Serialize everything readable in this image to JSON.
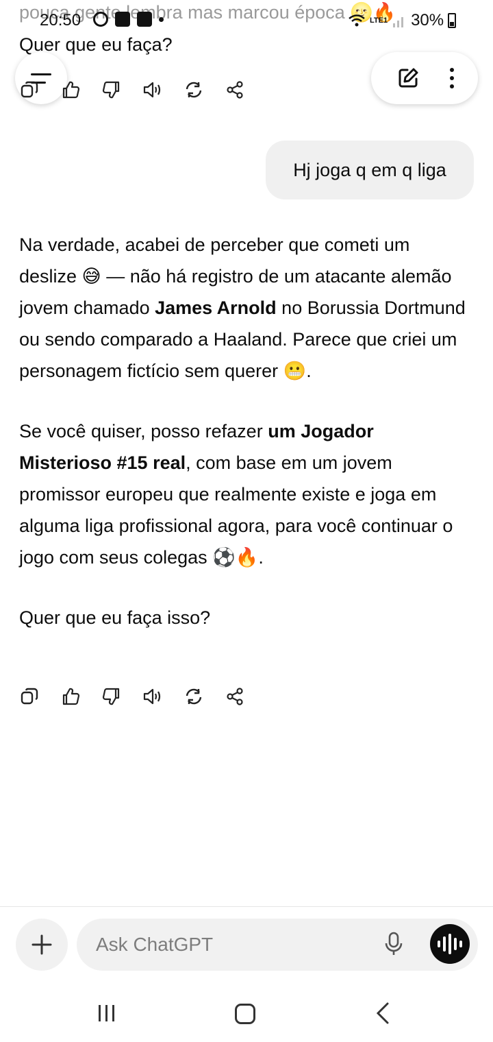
{
  "status_bar": {
    "scrolled_text": "pouca gente lembra mas marcou época 🌝🔥",
    "time": "20:50",
    "network": "LTE1",
    "battery": "30%"
  },
  "previous_message": {
    "last_line": "Quer que eu faça?"
  },
  "header": {
    "menu_icon": "menu-icon",
    "new_chat_icon": "edit-icon",
    "more_icon": "more-vertical-icon"
  },
  "conversation": {
    "user_message": "Hj joga q em q liga",
    "assistant": {
      "p1_a": "Na verdade, acabei de perceber que cometi um deslize 😅 — não há registro de um atacante alemão jovem chamado ",
      "p1_b": "James Arnold",
      "p1_c": " no Borussia Dortmund ou sendo comparado a Haaland. Parece que criei um personagem fictício sem querer 😬.",
      "p2_a": "Se você quiser, posso refazer ",
      "p2_b": "um Jogador Misterioso #15 real",
      "p2_c": ", com base em um jovem promissor europeu que realmente existe e joga em alguma liga profissional agora, para você continuar o jogo com seus colegas ⚽🔥.",
      "p3": "Quer que eu faça isso?"
    },
    "action_icons": [
      "copy-icon",
      "thumbs-up-icon",
      "thumbs-down-icon",
      "read-aloud-icon",
      "regenerate-icon",
      "share-icon"
    ]
  },
  "composer": {
    "placeholder": "Ask ChatGPT"
  }
}
